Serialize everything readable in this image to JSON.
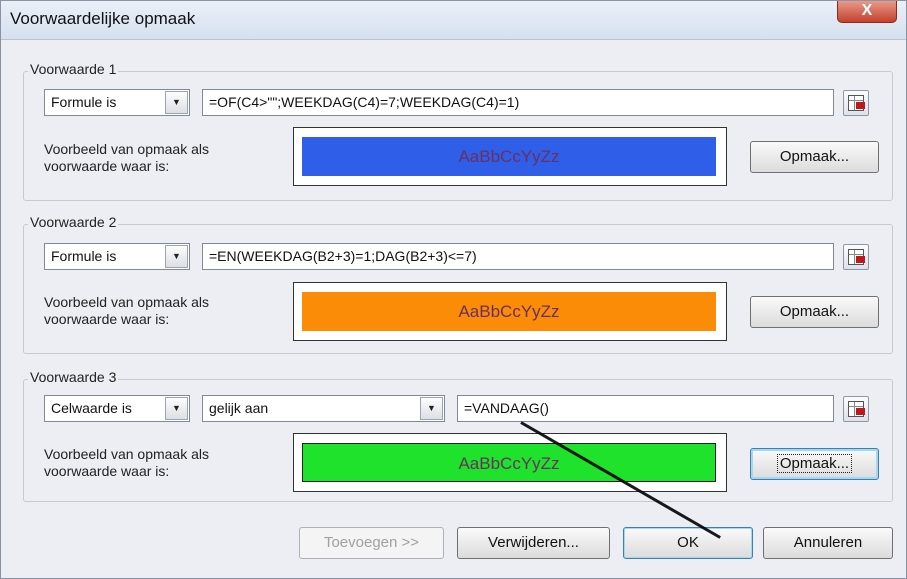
{
  "window": {
    "title": "Voorwaardelijke opmaak",
    "close_label": "X"
  },
  "conditions": [
    {
      "label": "Voorwaarde 1",
      "type": "Formule is",
      "formula": "=OF(C4>\"\";WEEKDAG(C4)=7;WEEKDAG(C4)=1)",
      "preview_label_line1": "Voorbeeld van opmaak als",
      "preview_label_line2": "voorwaarde waar is:",
      "preview_text": "AaBbCcYyZz",
      "preview_color": "#2f5fe8",
      "format_button": "Opmaak..."
    },
    {
      "label": "Voorwaarde 2",
      "type": "Formule is",
      "formula": "=EN(WEEKDAG(B2+3)=1;DAG(B2+3)<=7)",
      "preview_label_line1": "Voorbeeld van opmaak als",
      "preview_label_line2": "voorwaarde waar is:",
      "preview_text": "AaBbCcYyZz",
      "preview_color": "#fb8c07",
      "format_button": "Opmaak..."
    },
    {
      "label": "Voorwaarde 3",
      "type": "Celwaarde is",
      "operator": "gelijk aan",
      "value": "=VANDAAG()",
      "preview_label_line1": "Voorbeeld van opmaak als",
      "preview_label_line2": "voorwaarde waar is:",
      "preview_text": "AaBbCcYyZz",
      "preview_color": "#1fe22c",
      "format_button": "Opmaak..."
    }
  ],
  "footer": {
    "add_button": "Toevoegen >>",
    "remove_button": "Verwijderen...",
    "ok_button": "OK",
    "cancel_button": "Annuleren"
  }
}
